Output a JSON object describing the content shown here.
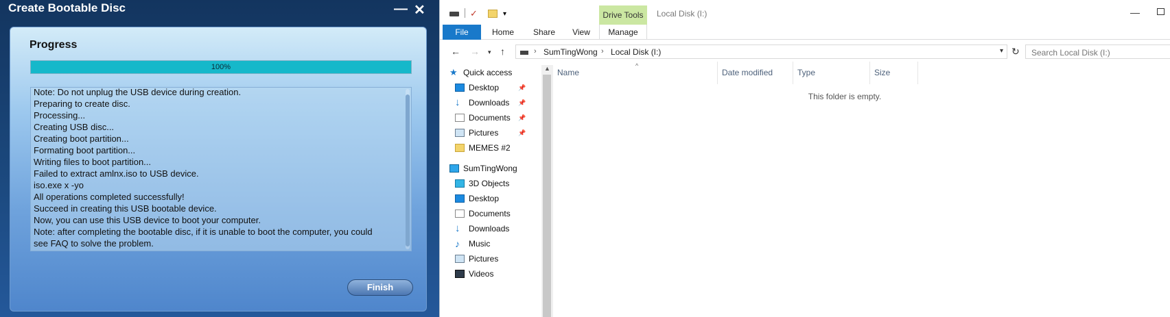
{
  "bootable": {
    "title": "Create Bootable Disc",
    "minimize_glyph": "—",
    "close_glyph": "✕",
    "section_heading": "Progress",
    "progress": {
      "value": 100,
      "label": "100%"
    },
    "log_lines": [
      "Note: Do not unplug the USB device during creation.",
      "Preparing to create disc.",
      "Processing...",
      "Creating USB disc...",
      "Creating boot partition...",
      "Formating boot partition...",
      "Writing files to boot partition...",
      "Failed to extract amlnx.iso to USB device.",
      "iso.exe x -yo",
      "All operations completed successfully!",
      "Succeed in creating this USB bootable device.",
      "Now, you can use this USB device to boot your computer.",
      "Note: after completing the bootable disc, if it is unable to boot the computer, you could",
      "see FAQ to solve the problem."
    ],
    "finish_label": "Finish"
  },
  "explorer": {
    "quick_access_arrow": "▾",
    "drive_tools_label": "Drive Tools",
    "window_title": "Local Disk (I:)",
    "minimize_glyph": "—",
    "tabs": {
      "file": "File",
      "home": "Home",
      "share": "Share",
      "view": "View",
      "manage": "Manage"
    },
    "nav": {
      "back": "←",
      "forward": "→",
      "recent": "▾",
      "up": "↑",
      "refresh": "↻"
    },
    "address": {
      "separator": "›",
      "crumbs": [
        "SumTingWong",
        "Local Disk (I:)"
      ],
      "dropdown": "▾"
    },
    "search_placeholder": "Search Local Disk (I:)",
    "sidebar": {
      "quick_access": "Quick access",
      "desktop": "Desktop",
      "downloads": "Downloads",
      "documents": "Documents",
      "pictures": "Pictures",
      "memes": "MEMES #2",
      "pc": "SumTingWong",
      "objects3d": "3D Objects",
      "desktop2": "Desktop",
      "documents2": "Documents",
      "downloads2": "Downloads",
      "music": "Music",
      "pictures2": "Pictures",
      "videos": "Videos"
    },
    "columns": {
      "name": "Name",
      "date": "Date modified",
      "type": "Type",
      "size": "Size"
    },
    "empty_message": "This folder is empty."
  }
}
